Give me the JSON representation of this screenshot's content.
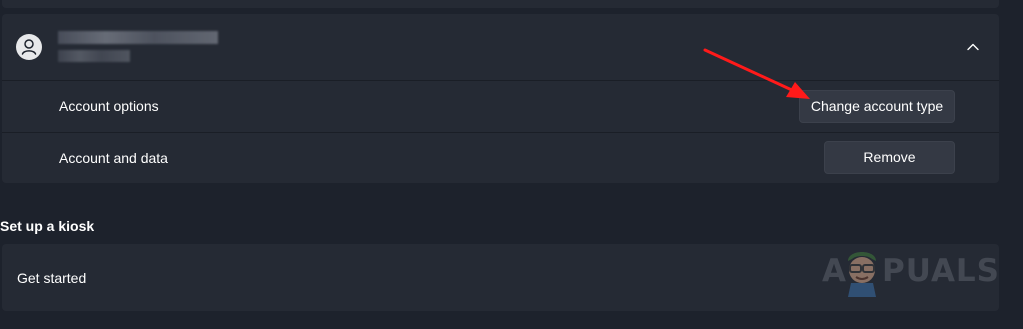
{
  "account": {
    "avatar_icon": "person-icon",
    "expand_icon": "chevron-up-icon",
    "rows": [
      {
        "label": "Account options",
        "button": "Change account type"
      },
      {
        "label": "Account and data",
        "button": "Remove"
      }
    ]
  },
  "kiosk": {
    "heading": "Set up a kiosk",
    "item_label": "Get started"
  },
  "annotation": {
    "arrow_color": "#ff1a1a"
  },
  "watermark": {
    "text_prefix": "A",
    "text_suffix": "PUALS"
  },
  "colors": {
    "background": "#1d222c",
    "card": "#252a34",
    "button": "#343944"
  }
}
